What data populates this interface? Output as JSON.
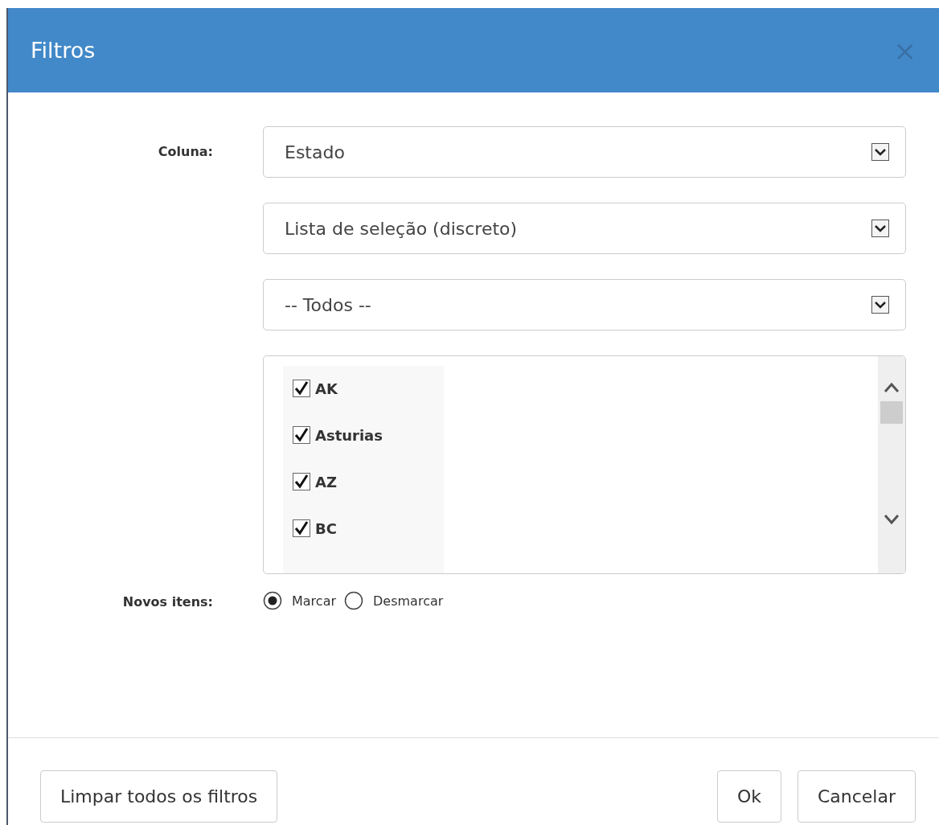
{
  "dialog": {
    "title": "Filtros",
    "close": "×"
  },
  "column_label": "Coluna:",
  "selects": [
    {
      "value": "Estado"
    },
    {
      "value": "Lista de seleção (discreto)"
    },
    {
      "value": "-- Todos --"
    }
  ],
  "items": [
    {
      "label": "AK",
      "checked": true
    },
    {
      "label": "Asturias",
      "checked": true
    },
    {
      "label": "AZ",
      "checked": true
    },
    {
      "label": "BC",
      "checked": true
    }
  ],
  "new_items": {
    "label": "Novos itens:",
    "options": [
      {
        "label": "Marcar",
        "selected": true
      },
      {
        "label": "Desmarcar",
        "selected": false
      }
    ]
  },
  "footer": {
    "clear": "Limpar todos os filtros",
    "ok": "Ok",
    "cancel": "Cancelar"
  }
}
